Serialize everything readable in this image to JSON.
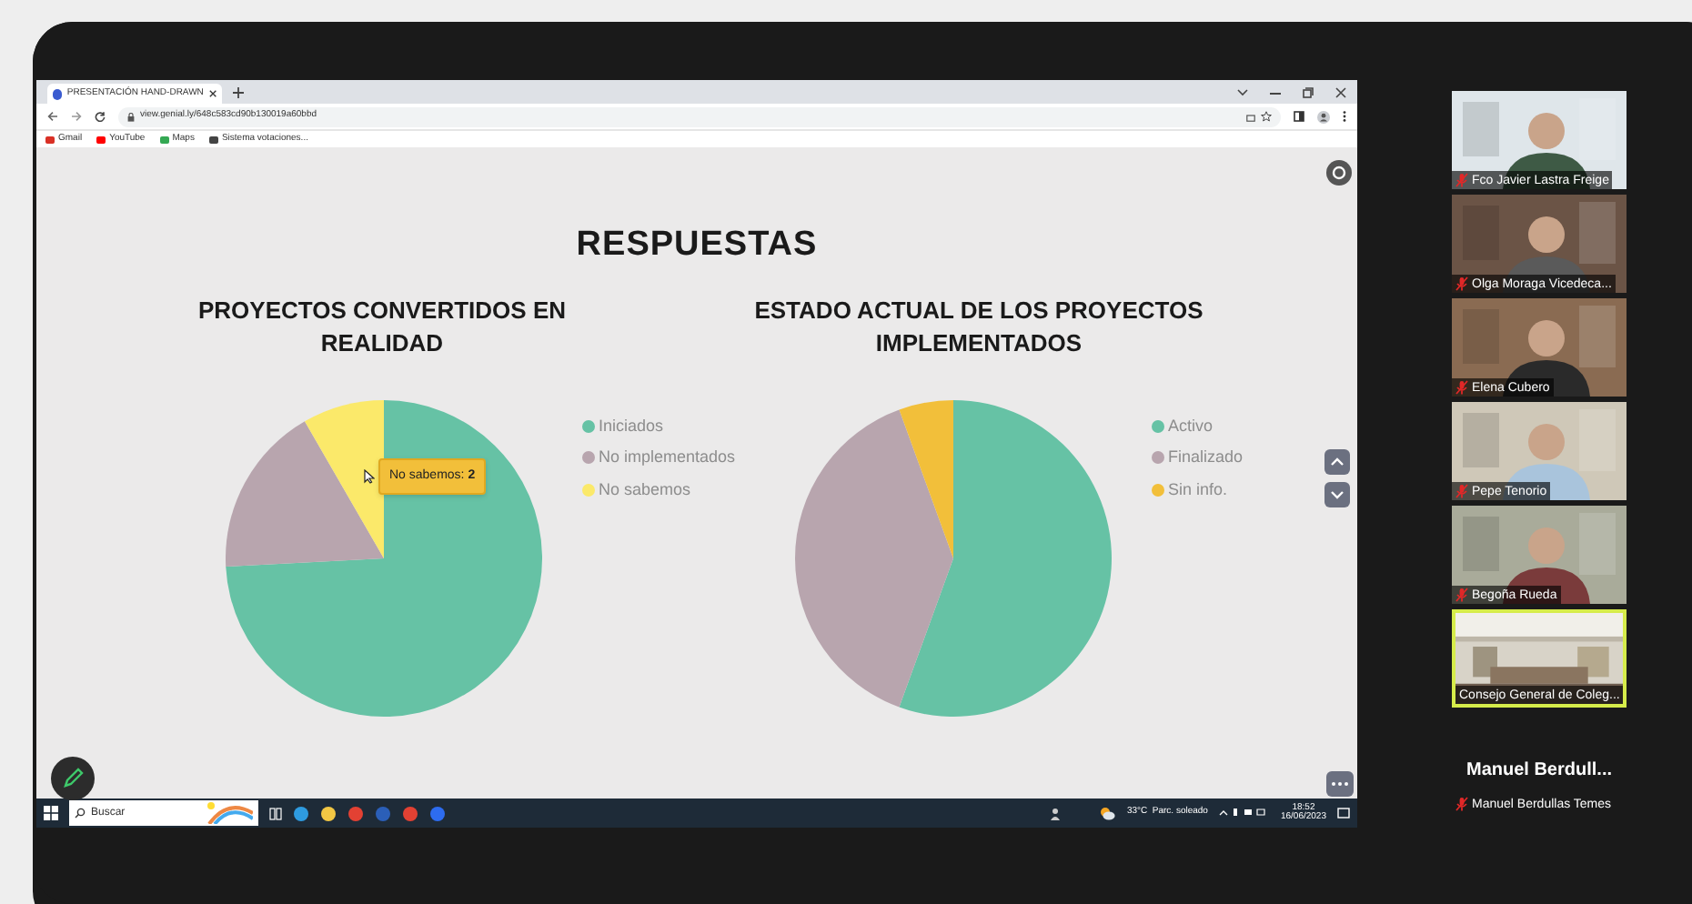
{
  "browser": {
    "tab_title": "PRESENTACIÓN HAND-DRAWN",
    "url": "view.genial.ly/648c583cd90b130019a60bbd",
    "bookmarks": [
      {
        "label": "Gmail",
        "color": "#d93025"
      },
      {
        "label": "YouTube",
        "color": "#ff0000"
      },
      {
        "label": "Maps",
        "color": "#34a853"
      },
      {
        "label": "Sistema votaciones...",
        "color": "#444444"
      }
    ]
  },
  "slide": {
    "title": "RESPUESTAS",
    "charts": [
      {
        "title": "PROYECTOS CONVERTIDOS EN REALIDAD",
        "legend": [
          {
            "label": "Iniciados",
            "color": "#66c2a5"
          },
          {
            "label": "No implementados",
            "color": "#b8a5ae"
          },
          {
            "label": "No sabemos",
            "color": "#fbe96a"
          }
        ],
        "tooltip": "No sabemos: **2**"
      },
      {
        "title": "ESTADO ACTUAL DE LOS PROYECTOS IMPLEMENTADOS",
        "legend": [
          {
            "label": "Activo",
            "color": "#66c2a5"
          },
          {
            "label": "Finalizado",
            "color": "#b8a5ae"
          },
          {
            "label": "Sin info.",
            "color": "#f2bf3a"
          }
        ]
      }
    ]
  },
  "taskbar": {
    "search_placeholder": "Buscar",
    "weather": "33°C  Parc. soleado",
    "time": "18:52",
    "date": "16/06/2023"
  },
  "participants": [
    {
      "kind": "video",
      "name": "Fco Javier Lastra Freige",
      "muted": true,
      "speaking": false
    },
    {
      "kind": "video",
      "name": "Olga Moraga Vicedeca...",
      "muted": true,
      "speaking": false
    },
    {
      "kind": "video",
      "name": "Elena Cubero",
      "muted": true,
      "speaking": false
    },
    {
      "kind": "video",
      "name": "Pepe Tenorio",
      "muted": true,
      "speaking": false
    },
    {
      "kind": "video",
      "name": "Begoña Rueda",
      "muted": true,
      "speaking": false
    },
    {
      "kind": "video",
      "name": "Consejo General de Coleg...",
      "muted": false,
      "speaking": true
    },
    {
      "kind": "no_video",
      "display_name": "Manuel  Berdull...",
      "name": "Manuel Berdullas Temes",
      "muted": true,
      "speaking": false
    }
  ]
}
